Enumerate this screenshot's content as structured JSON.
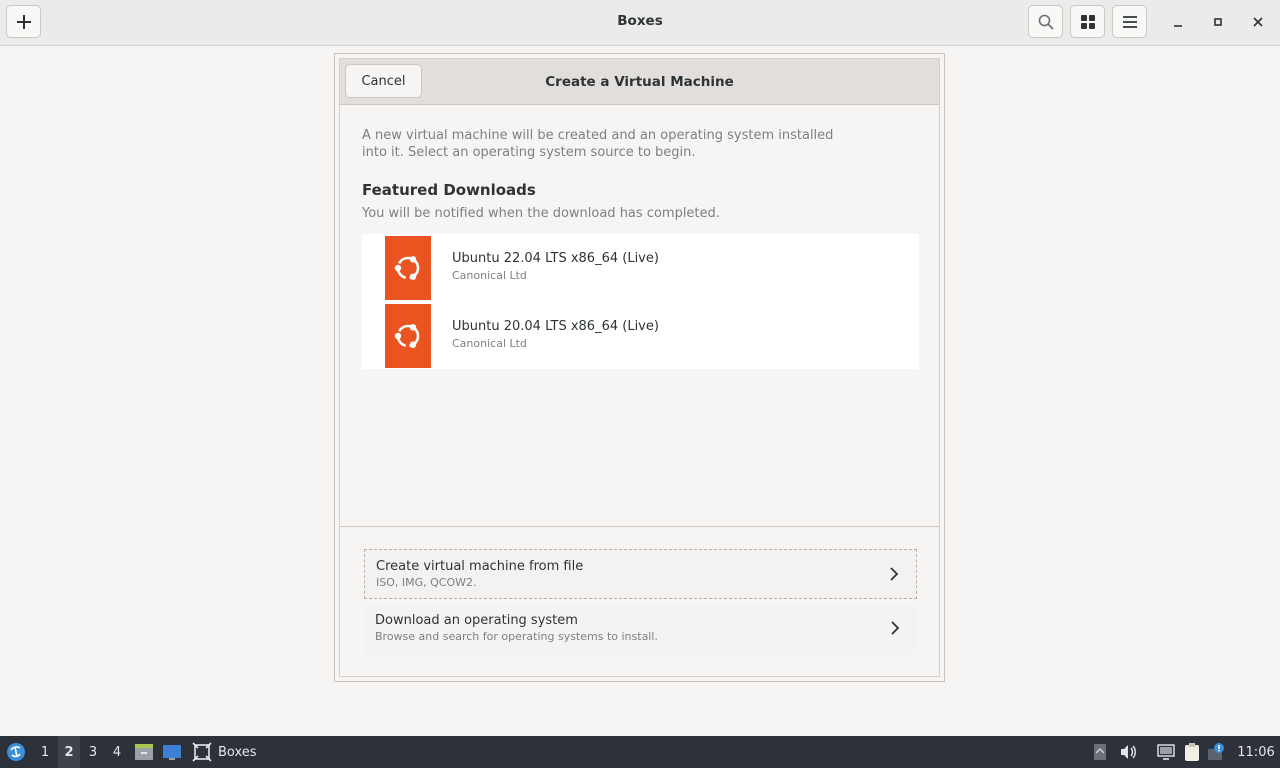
{
  "header": {
    "title": "Boxes",
    "new_button_icon": "plus-icon",
    "search_icon": "search-icon",
    "view_icon": "grid-view-icon",
    "menu_icon": "hamburger-menu-icon"
  },
  "dialog": {
    "cancel_label": "Cancel",
    "title": "Create a Virtual Machine",
    "intro_line1": "A new virtual machine will be created and an operating system installed",
    "intro_line2": "into it. Select an operating system source to begin.",
    "featured_title": "Featured Downloads",
    "featured_subtitle": "You will be notified when the download has completed.",
    "downloads": [
      {
        "name": "Ubuntu 22.04 LTS x86_64 (Live)",
        "vendor": "Canonical Ltd",
        "icon": "ubuntu-logo-icon"
      },
      {
        "name": "Ubuntu 20.04 LTS x86_64 (Live)",
        "vendor": "Canonical Ltd",
        "icon": "ubuntu-logo-icon"
      }
    ],
    "sources": [
      {
        "title": "Create virtual machine from file",
        "subtitle": "ISO, IMG, QCOW2."
      },
      {
        "title": "Download an operating system",
        "subtitle": "Browse and search for operating systems to install."
      }
    ]
  },
  "taskbar": {
    "workspaces": [
      "1",
      "2",
      "3",
      "4"
    ],
    "active_workspace": "2",
    "task_label": "Boxes",
    "clock": "11:06"
  },
  "colors": {
    "ubuntu_orange": "#e95420",
    "taskbar_bg": "#2d3139"
  }
}
